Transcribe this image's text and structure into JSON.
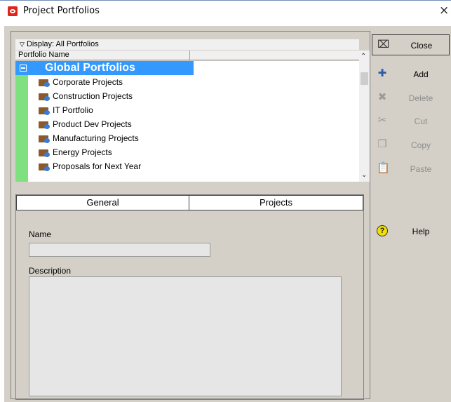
{
  "window": {
    "title": "Project Portfolios",
    "close_glyph": "×"
  },
  "list": {
    "display_label": "Display: All Portfolios",
    "column_header": "Portfolio Name",
    "group_label": "Global Portfolios",
    "items": [
      {
        "label": "Corporate Projects"
      },
      {
        "label": "Construction Projects"
      },
      {
        "label": "IT Portfolio"
      },
      {
        "label": "Product Dev Projects"
      },
      {
        "label": "Manufacturing Projects"
      },
      {
        "label": "Energy Projects"
      },
      {
        "label": "Proposals for Next Year"
      }
    ]
  },
  "tabs": {
    "general": "General",
    "projects": "Projects"
  },
  "general": {
    "name_label": "Name",
    "name_value": "",
    "description_label": "Description",
    "description_value": ""
  },
  "buttons": {
    "close": "Close",
    "add": "Add",
    "delete": "Delete",
    "cut": "Cut",
    "copy": "Copy",
    "paste": "Paste",
    "help": "Help"
  },
  "colors": {
    "selection": "#3399ff",
    "status_strip": "#7ee07e",
    "dialog_bg": "#d4d0c8"
  }
}
